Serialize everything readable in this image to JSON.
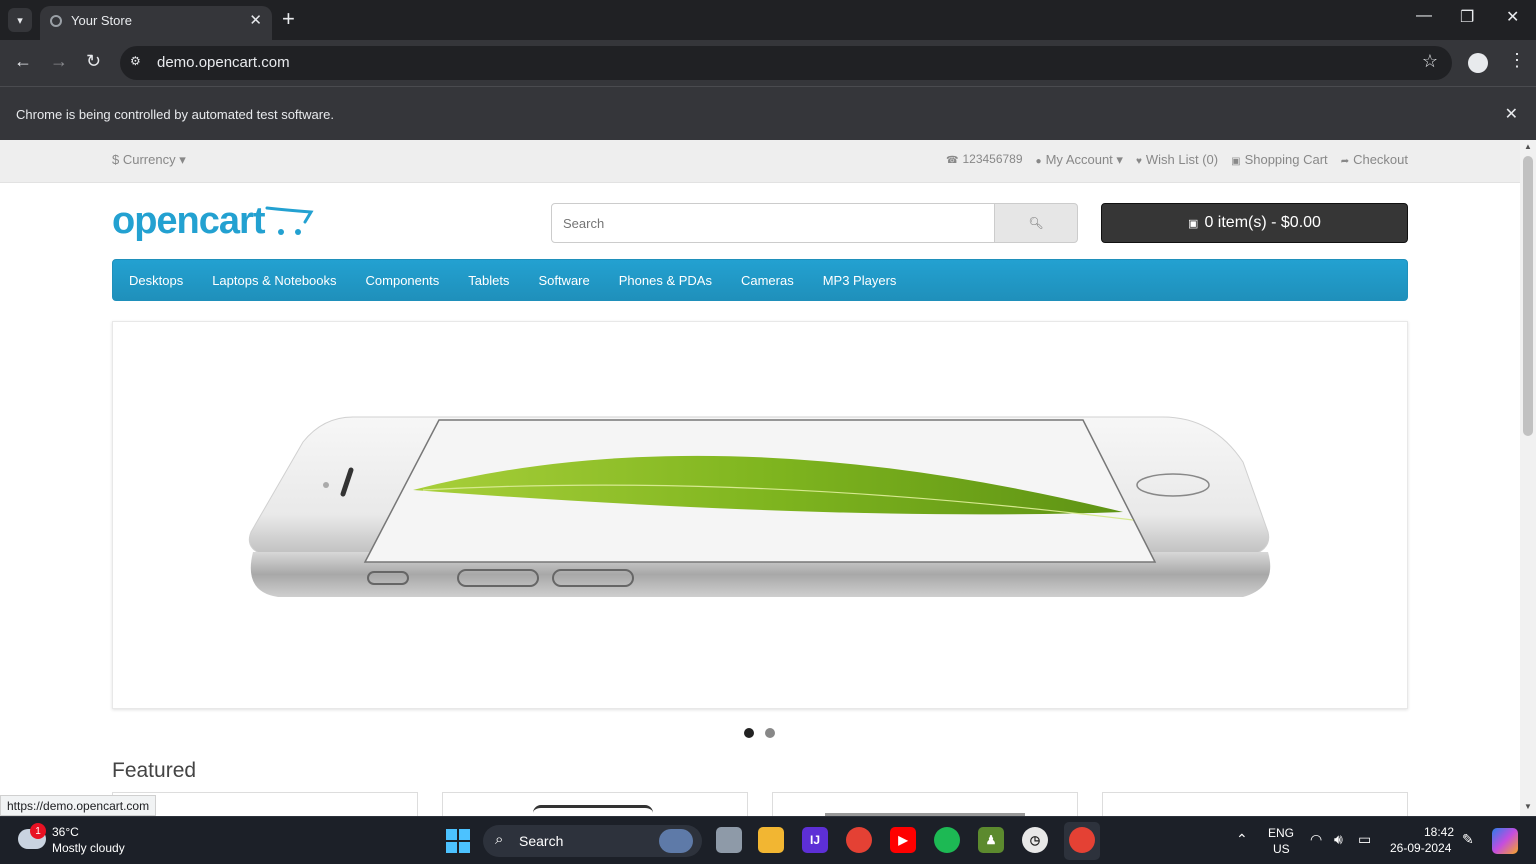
{
  "browser": {
    "tab_title": "Your Store",
    "url": "demo.opencart.com",
    "infobar_text": "Chrome is being controlled by automated test software.",
    "status_url": "https://demo.opencart.com"
  },
  "store": {
    "currency_label": "$ Currency",
    "top_links": {
      "phone": "123456789",
      "my_account": "My Account",
      "wish_list": "Wish List (0)",
      "shopping_cart": "Shopping Cart",
      "checkout": "Checkout"
    },
    "logo_text": "opencart",
    "search_placeholder": "Search",
    "cart_label": "0 item(s) - $0.00",
    "menu": [
      "Desktops",
      "Laptops & Notebooks",
      "Components",
      "Tablets",
      "Software",
      "Phones & PDAs",
      "Cameras",
      "MP3 Players"
    ],
    "slideshow": {
      "slide_count": 2,
      "active_slide": 1
    },
    "featured_title": "Featured",
    "colors": {
      "brand": "#23a1d1",
      "cart_button": "#363636"
    }
  },
  "taskbar": {
    "weather_badge": "1",
    "temperature": "36°C",
    "condition": "Mostly cloudy",
    "search_label": "Search",
    "lang_primary": "ENG",
    "lang_secondary": "US",
    "time": "18:42",
    "date": "26-09-2024"
  }
}
